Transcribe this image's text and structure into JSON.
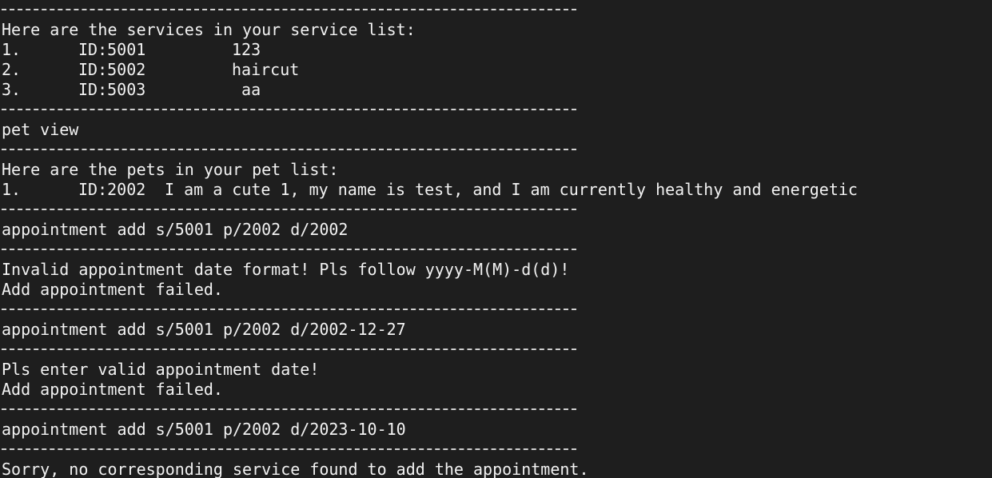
{
  "terminal": {
    "service_list_header": "Here are the services in your service list:",
    "services": [
      {
        "num": "1.",
        "id": "ID:5001",
        "name": "123"
      },
      {
        "num": "2.",
        "id": "ID:5002",
        "name": "haircut"
      },
      {
        "num": "3.",
        "id": "ID:5003",
        "name": " aa"
      }
    ],
    "cmd_pet_view": "pet view",
    "pet_list_header": "Here are the pets in your pet list:",
    "pets": [
      {
        "num": "1.",
        "id": "ID:2002",
        "desc": "I am a cute 1, my name is test, and I am currently healthy and energetic"
      }
    ],
    "cmd_1": "appointment add s/5001 p/2002 d/2002",
    "err_1a": "Invalid appointment date format! Pls follow yyyy-M(M)-d(d)!",
    "err_1b": "Add appointment failed.",
    "cmd_2": "appointment add s/5001 p/2002 d/2002-12-27",
    "err_2a": "Pls enter valid appointment date!",
    "err_2b": "Add appointment failed.",
    "cmd_3": "appointment add s/5001 p/2002 d/2023-10-10",
    "err_3a": "Sorry, no corresponding service found to add the appointment."
  },
  "colors": {
    "background": "#1e1e1e",
    "text": "#f2f2f2"
  }
}
